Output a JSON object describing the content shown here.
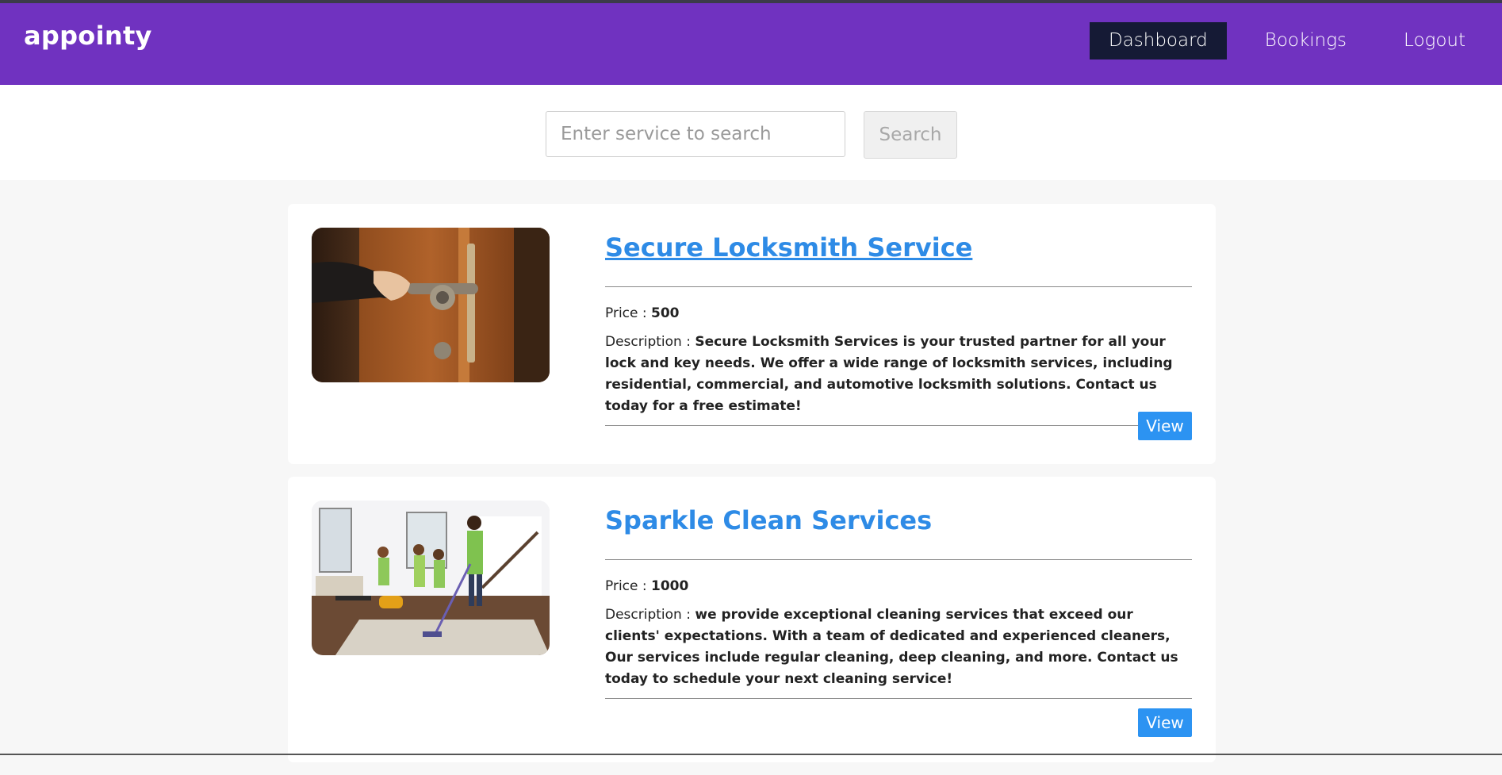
{
  "app": {
    "brand": "appointy"
  },
  "nav": {
    "items": [
      {
        "label": "Dashboard",
        "active": true
      },
      {
        "label": "Bookings",
        "active": false
      },
      {
        "label": "Logout",
        "active": false
      }
    ]
  },
  "search": {
    "placeholder": "Enter service to search",
    "value": "",
    "button_label": "Search"
  },
  "services": [
    {
      "title": "Secure Locksmith Service",
      "price_label": "Price : ",
      "price": "500",
      "description_label": "Description : ",
      "description": "Secure Locksmith Services is your trusted partner for all your lock and key needs. We offer a wide range of locksmith services, including residential, commercial, and automotive locksmith solutions. Contact us today for a free estimate!",
      "view_label": "View",
      "image_icon": "door-handle-photo"
    },
    {
      "title": "Sparkle Clean Services",
      "price_label": "Price : ",
      "price": "1000",
      "description_label": "Description : ",
      "description": "we provide exceptional cleaning services that exceed our clients' expectations. With a team of dedicated and experienced cleaners, Our services include regular cleaning, deep cleaning, and more. Contact us today to schedule your next cleaning service!",
      "view_label": "View",
      "image_icon": "cleaning-team-photo"
    }
  ],
  "colors": {
    "navbar": "#7032c0",
    "nav_active": "#151a35",
    "link": "#2e8be6",
    "button": "#2c93f2"
  }
}
